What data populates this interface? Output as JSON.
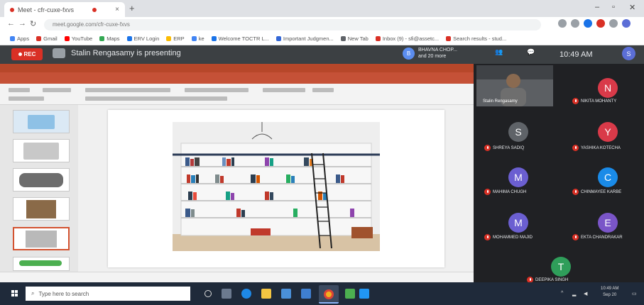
{
  "browser": {
    "tab_title": "Meet - cfr-cuxe-fxvs",
    "new_tab": "+",
    "address": "meet.google.com/cfr-cuxe-fxvs",
    "bookmarks": [
      {
        "label": "Apps",
        "color": "#4285f4"
      },
      {
        "label": "Gmail",
        "color": "#d93025"
      },
      {
        "label": "YouTube",
        "color": "#ff0000"
      },
      {
        "label": "Maps",
        "color": "#34a853"
      },
      {
        "label": "ERV Login",
        "color": "#1a73e8"
      },
      {
        "label": "ERP",
        "color": "#fbbc04"
      },
      {
        "label": "ke",
        "color": "#4285f4"
      },
      {
        "label": "Welcome TOCTR L...",
        "color": "#1a73e8"
      },
      {
        "label": "Important Judgmen...",
        "color": "#3367d6"
      },
      {
        "label": "New Tab",
        "color": "#5f6368"
      },
      {
        "label": "Inbox (9) - sfi@assetc...",
        "color": "#d93025"
      },
      {
        "label": "Search results - stud...",
        "color": "#d93025"
      }
    ]
  },
  "meet": {
    "rec_label": "REC",
    "presenter_text": "Stalin Rengasamy is presenting",
    "viewer_initial": "B",
    "viewer_name": "BHAVNA CHOP...",
    "viewer_more": "and 20 more",
    "clock": "10:49 AM",
    "you_initial": "S",
    "camera_name": "Stalin Rengasamy",
    "participants": [
      {
        "initial": "N",
        "name": "NIKITA MOHANTY",
        "color": "#d93a49"
      },
      {
        "initial": "S",
        "name": "SHREYA SADIQ",
        "color": "#5f6368"
      },
      {
        "initial": "Y",
        "name": "YASHIKA KOTECHA",
        "color": "#d93a49"
      },
      {
        "initial": "M",
        "name": "MAHIMA CHUGH",
        "color": "#6b5fd1"
      },
      {
        "initial": "C",
        "name": "CHINMAYEE KARBE",
        "color": "#1a8be8"
      },
      {
        "initial": "M",
        "name": "MOHAMMED MAJID",
        "color": "#6b5fd1"
      },
      {
        "initial": "E",
        "name": "EKTA CHANDRAKAR",
        "color": "#7a55c8"
      },
      {
        "initial": "T",
        "name": "DEEPIKA SINGH",
        "color": "#2f9e5a"
      }
    ]
  },
  "taskbar": {
    "search_placeholder": "Type here to search",
    "time": "10:49 AM",
    "date": "Sep 20"
  },
  "colors": {
    "accent": "#d93025",
    "ppt_red": "#c55137",
    "meet_bg": "#202124"
  }
}
